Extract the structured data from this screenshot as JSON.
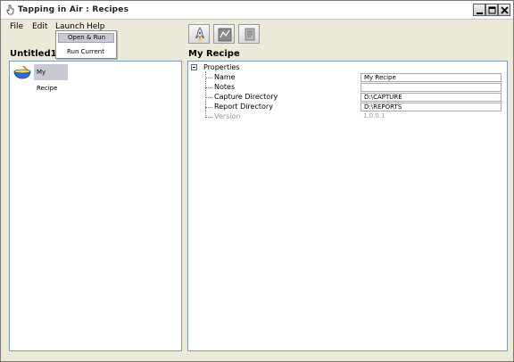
{
  "window": {
    "title": "Tapping in Air : Recipes"
  },
  "menubar": {
    "file": "File",
    "edit": "Edit",
    "launch": "Launch",
    "help": "Help"
  },
  "launch_menu": {
    "items": [
      "Open & Run",
      "Run Current"
    ]
  },
  "toolbar": {
    "icons": [
      "rocket-icon",
      "report-chart-icon",
      "document-icon"
    ]
  },
  "left_panel": {
    "heading": "Untitled1.recipe",
    "recipe_label": "My Recipe"
  },
  "right_panel": {
    "heading": "My Recipe",
    "root": "Properties",
    "properties": [
      {
        "name": "Name",
        "value": "My Recipe"
      },
      {
        "name": "Notes",
        "value": ""
      },
      {
        "name": "Capture Directory",
        "value": "D:\\CAPTURE"
      },
      {
        "name": "Report Directory",
        "value": "D:\\REPORTS"
      },
      {
        "name": "Version",
        "value": "1.0.0.1"
      }
    ]
  },
  "colors": {
    "selection": "#c9c9d6",
    "panel_border": "#7f9db9",
    "chrome": "#ece9d8"
  }
}
